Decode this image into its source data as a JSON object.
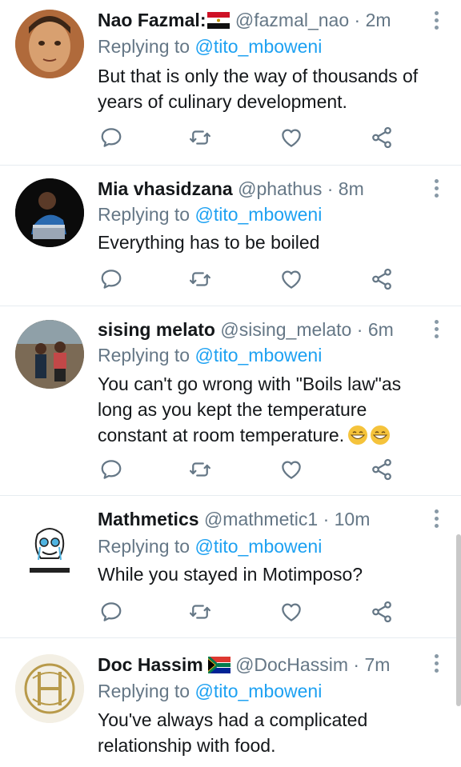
{
  "tweets": [
    {
      "name": "Nao Fazmal:",
      "flag": "egypt-flag-icon",
      "handle": "@fazmal_nao",
      "dot": "·",
      "time": "2m",
      "replying_prefix": "Replying to ",
      "replying_to": "@tito_mboweni",
      "body_lines": [
        "But that is only the way of thousands of",
        "years of culinary development."
      ]
    },
    {
      "name": "Mia vhasidzana",
      "handle": "@phathus",
      "dot": "·",
      "time": "8m",
      "replying_prefix": "Replying to ",
      "replying_to": "@tito_mboweni",
      "body_lines": [
        "Everything has to be boiled"
      ]
    },
    {
      "name": "sising melato",
      "handle": "@sising_melato",
      "dot": "·",
      "time": "6m",
      "replying_prefix": "Replying to ",
      "replying_to": "@tito_mboweni",
      "body_lines": [
        "You can't go wrong with \"Boils law\"as",
        "long as you kept the temperature",
        "constant at room temperature."
      ],
      "trailing_emoji": "grinning-face-icon"
    },
    {
      "name": "Mathmetics",
      "handle": "@mathmetic1",
      "dot": "·",
      "time": "10m",
      "replying_prefix": "Replying to ",
      "replying_to": "@tito_mboweni",
      "body_lines": [
        "While you stayed in Motimposo?"
      ]
    },
    {
      "name": "Doc Hassim",
      "flag": "south-africa-flag-icon",
      "handle": "@DocHassim",
      "dot": "·",
      "time": "7m",
      "replying_prefix": "Replying to ",
      "replying_to": "@tito_mboweni",
      "body_lines": [
        "You've always had a complicated",
        "relationship with food."
      ]
    }
  ],
  "icons": {
    "reply": "reply-icon",
    "retweet": "retweet-icon",
    "like": "heart-icon",
    "share": "share-icon",
    "more": "more-vertical-icon"
  },
  "colors": {
    "text": "#14171a",
    "muted": "#657786",
    "link": "#1da1f2",
    "divider": "#e6ecf0",
    "icon": "#657786"
  }
}
